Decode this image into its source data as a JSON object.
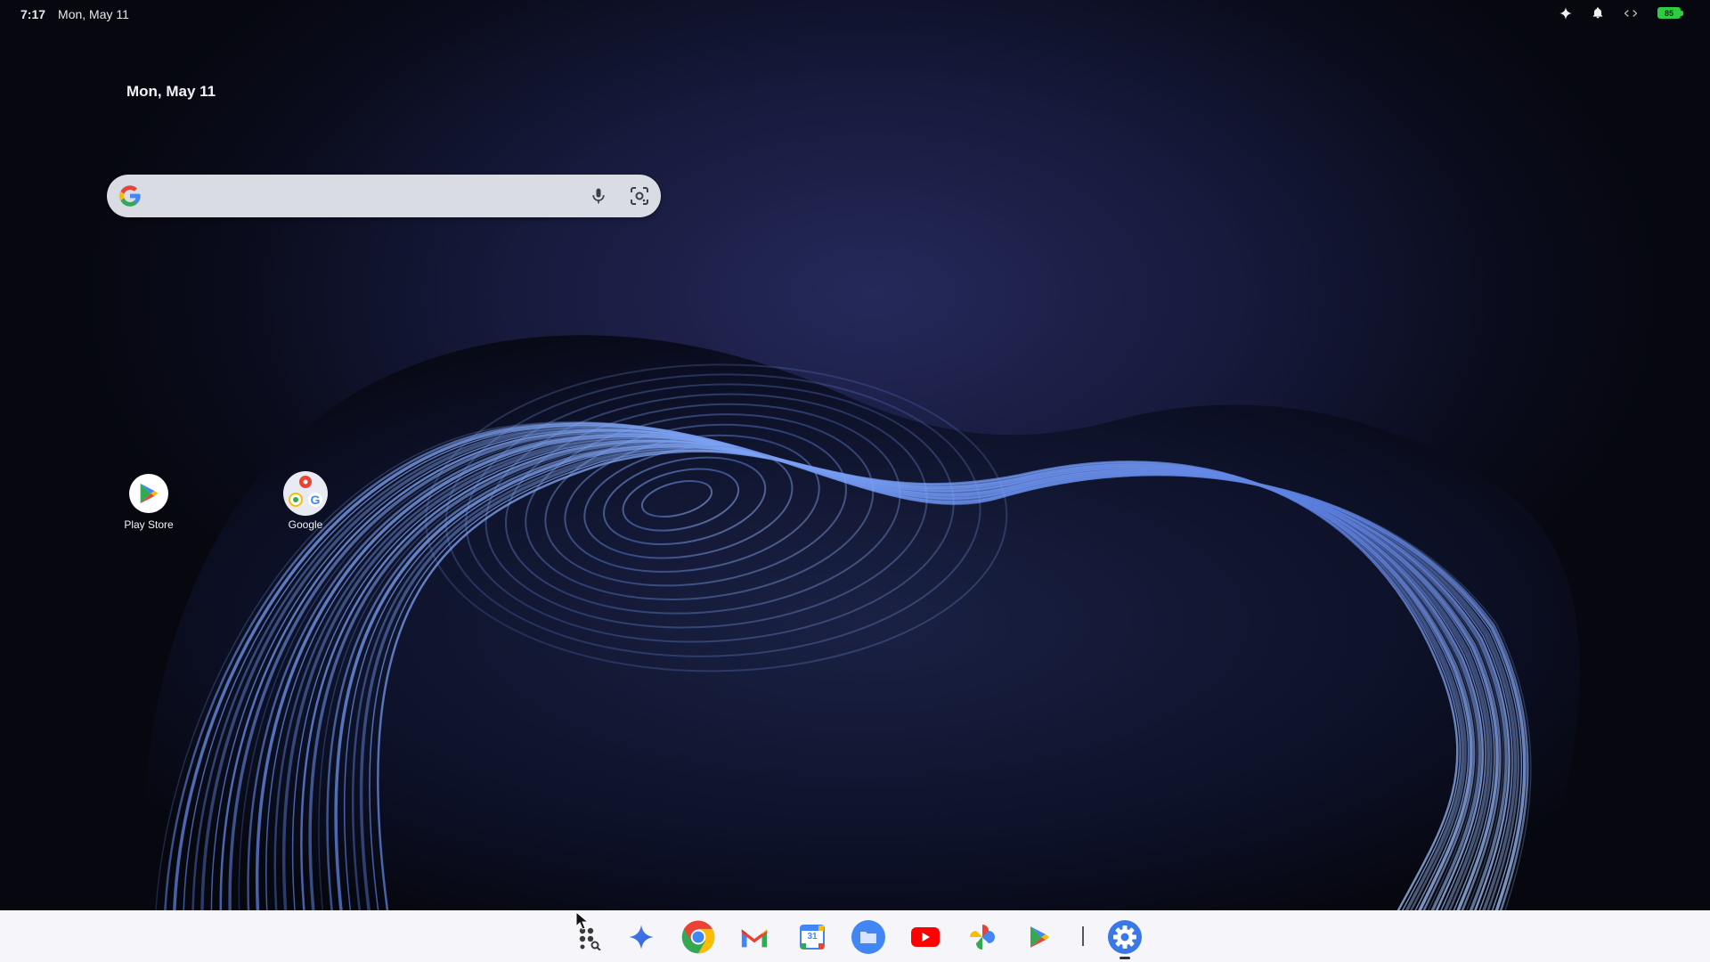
{
  "status_bar": {
    "time": "7:17",
    "date": "Mon, May 11",
    "battery_level": "85"
  },
  "widget": {
    "date": "Mon, May 11"
  },
  "search": {
    "placeholder": "",
    "value": ""
  },
  "desktop_icons": [
    {
      "label": "Play Store",
      "icon": "play-store-icon"
    },
    {
      "label": "Google",
      "icon": "google-folder-icon"
    }
  ],
  "taskbar": {
    "items": [
      {
        "name": "launcher",
        "icon": "launcher-icon"
      },
      {
        "name": "gemini",
        "icon": "gemini-icon"
      },
      {
        "name": "chrome",
        "icon": "chrome-icon"
      },
      {
        "name": "gmail",
        "icon": "gmail-icon"
      },
      {
        "name": "calendar",
        "icon": "calendar-icon",
        "day": "31"
      },
      {
        "name": "files",
        "icon": "files-icon"
      },
      {
        "name": "youtube",
        "icon": "youtube-icon"
      },
      {
        "name": "photos",
        "icon": "photos-icon"
      },
      {
        "name": "play-store",
        "icon": "play-store-icon"
      },
      {
        "name": "settings",
        "icon": "settings-icon"
      }
    ]
  },
  "colors": {
    "background": "#0a0c1c",
    "taskbar": "#f6f6fa",
    "battery": "#2ecc40",
    "google_blue": "#4285F4",
    "google_red": "#EA4335",
    "google_yellow": "#FBBC05",
    "google_green": "#34A853"
  }
}
